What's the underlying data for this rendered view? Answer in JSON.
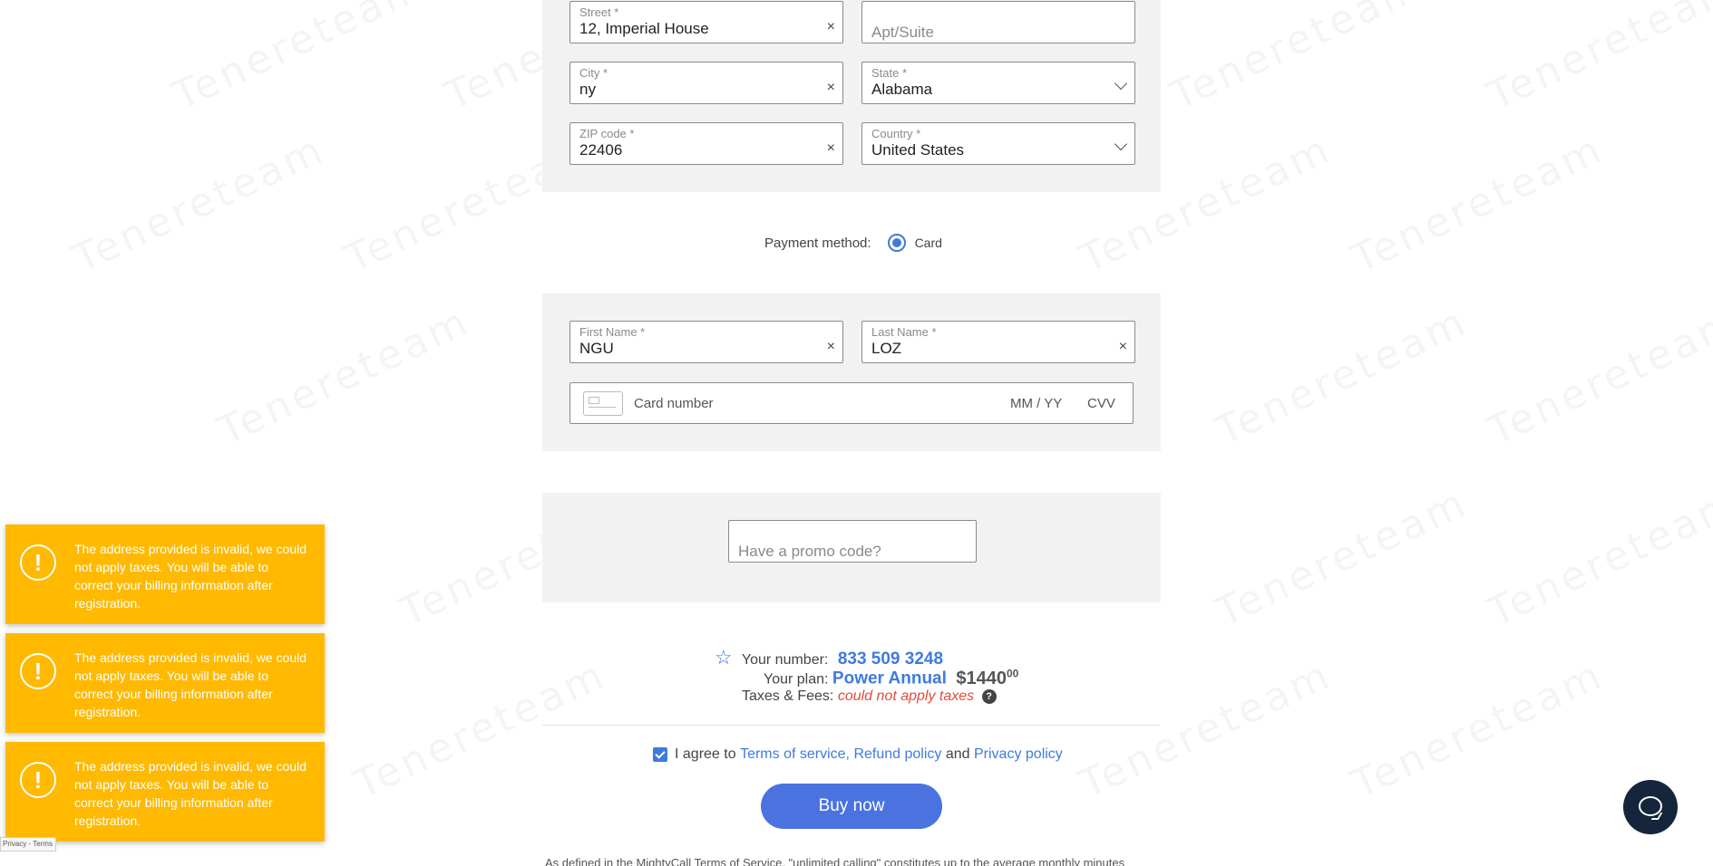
{
  "watermark": {
    "text": "Tenereteam"
  },
  "address": {
    "street": {
      "label": "Street *",
      "value": "12, Imperial House"
    },
    "apt": {
      "placeholder": "Apt/Suite"
    },
    "city": {
      "label": "City *",
      "value": "ny"
    },
    "state": {
      "label": "State *",
      "value": "Alabama"
    },
    "zip": {
      "label": "ZIP code *",
      "value": "22406"
    },
    "country": {
      "label": "Country *",
      "value": "United States"
    }
  },
  "payment": {
    "method_label": "Payment method:",
    "card_option": "Card"
  },
  "card": {
    "first_name": {
      "label": "First Name *",
      "value": "NGU"
    },
    "last_name": {
      "label": "Last Name *",
      "value": "LOZ"
    },
    "number_placeholder": "Card number",
    "expiry_placeholder": "MM / YY",
    "cvv_placeholder": "CVV"
  },
  "promo": {
    "placeholder": "Have a promo code?"
  },
  "summary": {
    "number_label": "Your number:",
    "number_value": "833 509 3248",
    "plan_label": "Your plan:",
    "plan_value": "Power Annual",
    "price_main": "$1440",
    "price_cents": "00",
    "taxes_label": "Taxes & Fees:",
    "taxes_value": "could not apply taxes",
    "help_glyph": "?"
  },
  "agreement": {
    "prefix": "I agree to",
    "terms": "Terms of service,",
    "refund": "Refund policy",
    "and": "and",
    "privacy": "Privacy policy"
  },
  "buy_label": "Buy now",
  "footnote": "As defined in the MightyCall Terms of Service, \"unlimited calling\" constitutes up to the average monthly minutes",
  "toasts": [
    {
      "message": "The address provided is invalid, we could not apply taxes. You will be able to correct your billing information after registration."
    },
    {
      "message": "The address provided is invalid, we could not apply taxes. You will be able to correct your billing information after registration."
    },
    {
      "message": "The address provided is invalid, we could not apply taxes. You will be able to correct your billing information after registration."
    }
  ],
  "recaptcha_label": "Privacy - Terms",
  "icons": {
    "clear": "×",
    "alert": "!",
    "star": "☆"
  },
  "colors": {
    "accent": "#3f7ae0",
    "button": "#4a73e0",
    "toast": "#ffb900",
    "error_text": "#e04a3f",
    "panel": "#f2f2f2",
    "chat": "#15263c"
  }
}
